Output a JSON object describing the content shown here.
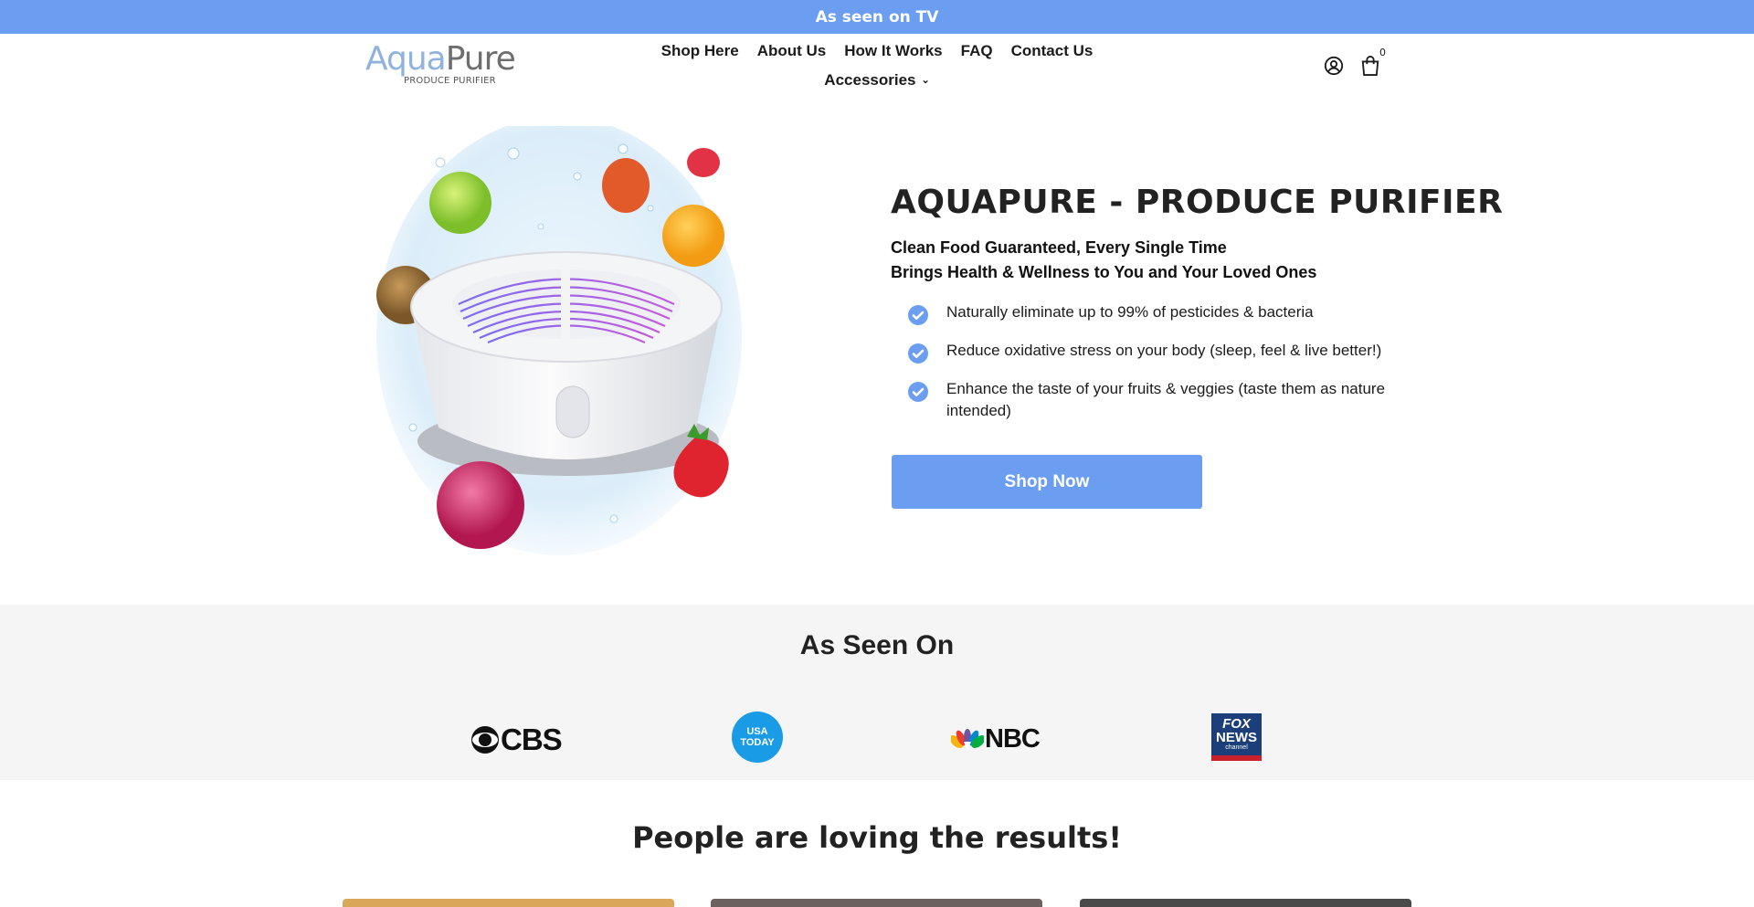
{
  "announcement": "As seen on TV",
  "logo": {
    "word_a": "Aqua",
    "word_b": "Pure",
    "tagline": "PRODUCE PURIFIER"
  },
  "nav": {
    "row1": [
      "Shop Here",
      "About Us",
      "How It Works",
      "FAQ",
      "Contact Us"
    ],
    "accessories": "Accessories"
  },
  "header_icons": {
    "account": "user-circle-icon",
    "cart": "shopping-bag-icon",
    "cart_count": "0"
  },
  "hero": {
    "title": "AQUAPURE - PRODUCE PURIFIER",
    "subtitle_1": "Clean Food Guaranteed, Every Single Time",
    "subtitle_2": "Brings Health & Wellness to You and Your Loved Ones",
    "benefits": [
      "Naturally eliminate up to 99% of pesticides & bacteria",
      "Reduce oxidative stress on your body (sleep, feel & live better!)",
      "Enhance the taste of your fruits & veggies (taste them as nature intended)"
    ],
    "cta": "Shop Now"
  },
  "as_seen_on": {
    "title": "As Seen On",
    "brands": {
      "cbs": "CBS",
      "usa_today_1": "USA",
      "usa_today_2": "TODAY",
      "nbc": "NBC",
      "fox_1": "FOX",
      "fox_2": "NEWS",
      "fox_3": "channel"
    }
  },
  "reviews": {
    "title": "People are loving the results!"
  },
  "colors": {
    "accent": "#6b9ef0",
    "section_bg": "#f5f5f5",
    "text": "#1b1b1b"
  }
}
